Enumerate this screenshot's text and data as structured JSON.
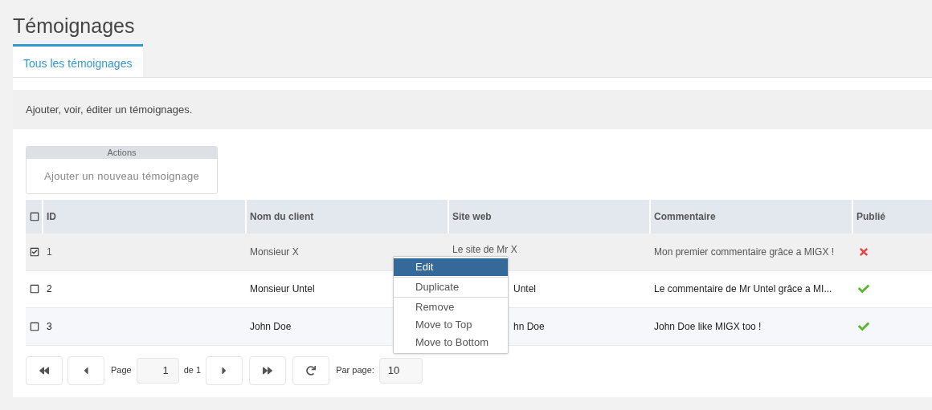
{
  "title": "Témoignages",
  "tabs": [
    {
      "label": "Tous les témoignages",
      "selected": true
    }
  ],
  "description": "Ajouter, voir, éditer un témoignages.",
  "actions": {
    "heading": "Actions",
    "buttons": [
      "Ajouter un nouveau témoignage"
    ]
  },
  "table": {
    "select_all": {
      "checked": false
    },
    "columns": [
      "ID",
      "Nom du client",
      "Site web",
      "Commentaire",
      "Publié"
    ],
    "rows": [
      {
        "selected": true,
        "checked": true,
        "id": "1",
        "name": "Monsieur X",
        "site": "Le site de Mr X",
        "site_covered": false,
        "comment": "Mon premier commentaire grâce a MIGX !",
        "published": false
      },
      {
        "selected": false,
        "checked": false,
        "id": "2",
        "name": "Monsieur Untel",
        "site": "Untel",
        "site_covered": true,
        "comment": "Le commentaire de Mr Untel grâce a MI...",
        "published": true
      },
      {
        "selected": false,
        "checked": false,
        "id": "3",
        "name": "John Doe",
        "site": "hn Doe",
        "site_covered": true,
        "comment": "John Doe like MIGX too !",
        "published": true
      }
    ]
  },
  "context_menu": {
    "groups": [
      [
        {
          "label": "Edit",
          "selected": true
        }
      ],
      [
        {
          "label": "Duplicate",
          "selected": false
        }
      ],
      [
        {
          "label": "Remove",
          "selected": false
        },
        {
          "label": "Move to Top",
          "selected": false
        },
        {
          "label": "Move to Bottom",
          "selected": false
        }
      ]
    ]
  },
  "pager": {
    "page_label": "Page",
    "page": "1",
    "of_label": "de 1",
    "per_page_label": "Par page:",
    "per_page": "10"
  }
}
